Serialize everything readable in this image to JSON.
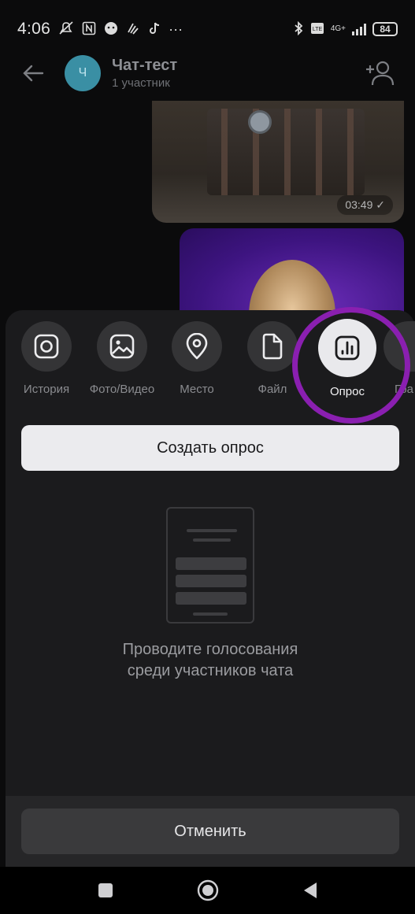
{
  "status_bar": {
    "time": "4:06",
    "more": "···",
    "network": "4G+",
    "battery": "84"
  },
  "header": {
    "avatar_letter": "Ч",
    "title": "Чат-тест",
    "subtitle": "1 участник"
  },
  "messages": {
    "photo_time": "03:49"
  },
  "attachments": [
    {
      "label": "История",
      "icon": "instagram-icon"
    },
    {
      "label": "Фото/Видео",
      "icon": "image-icon"
    },
    {
      "label": "Место",
      "icon": "location-pin-icon"
    },
    {
      "label": "Файл",
      "icon": "file-icon"
    },
    {
      "label": "Опрос",
      "icon": "poll-chart-icon",
      "selected": true
    },
    {
      "label": "Гра",
      "icon": "graffiti-icon"
    }
  ],
  "create_poll_label": "Создать опрос",
  "empty_state": {
    "line1": "Проводите голосования",
    "line2": "среди участников чата"
  },
  "cancel_label": "Отменить",
  "colors": {
    "highlight_ring": "#8a1fb0",
    "avatar": "#3a8fa4",
    "sheet_bg": "#1b1b1d"
  }
}
